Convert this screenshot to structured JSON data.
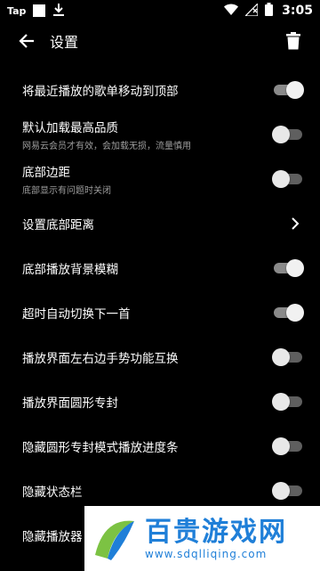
{
  "status_bar": {
    "app_label": "Tap",
    "time": "3:05"
  },
  "toolbar": {
    "title": "设置"
  },
  "settings": [
    {
      "label": "将最近播放的歌单移动到顶部",
      "sub": "",
      "control": "toggle",
      "on": true
    },
    {
      "label": "默认加载最高品质",
      "sub": "网易云会员才有效，会加载无损，流量慎用",
      "control": "toggle",
      "on": false
    },
    {
      "label": "底部边距",
      "sub": "底部显示有问题时关闭",
      "control": "toggle",
      "on": false
    },
    {
      "label": "设置底部距离",
      "sub": "",
      "control": "chevron",
      "on": false
    },
    {
      "label": "底部播放背景模糊",
      "sub": "",
      "control": "toggle",
      "on": true
    },
    {
      "label": "超时自动切换下一首",
      "sub": "",
      "control": "toggle",
      "on": true
    },
    {
      "label": "播放界面左右边手势功能互换",
      "sub": "",
      "control": "toggle",
      "on": false
    },
    {
      "label": "播放界面圆形专封",
      "sub": "",
      "control": "toggle",
      "on": false
    },
    {
      "label": "隐藏圆形专封模式播放进度条",
      "sub": "",
      "control": "toggle",
      "on": false
    },
    {
      "label": "隐藏状态栏",
      "sub": "",
      "control": "toggle",
      "on": false
    },
    {
      "label": "隐藏播放器",
      "sub": "",
      "control": "toggle",
      "on": false
    }
  ],
  "watermark": {
    "name": "百贵游戏网",
    "url": "www.sdqlliqing.com"
  },
  "colors": {
    "background": "#000000",
    "text": "#ffffff",
    "subtext": "#9e9e9e",
    "watermark": "#1f7fd8"
  }
}
